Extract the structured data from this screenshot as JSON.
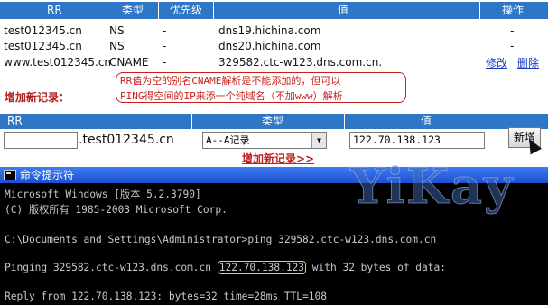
{
  "records_table": {
    "headers": [
      "RR",
      "类型",
      "优先级",
      "值",
      "操作"
    ],
    "rows": [
      {
        "rr": "test012345.cn",
        "type": "NS",
        "priority": "-",
        "value": "dns19.hichina.com",
        "action1": "",
        "action2": "-"
      },
      {
        "rr": "test012345.cn",
        "type": "NS",
        "priority": "-",
        "value": "dns20.hichina.com",
        "action1": "",
        "action2": "-"
      },
      {
        "rr": "www.test012345.cn",
        "type": "CNAME",
        "priority": "-",
        "value": "329582.ctc-w123.dns.com.cn.",
        "action1": "修改",
        "action2": "删除"
      }
    ]
  },
  "note": {
    "line1": "RR值为空的别名CNAME解析是不能添加的，但可以",
    "line2": "PING得空间的IP来添一个纯域名（不加www）解析"
  },
  "add_record": {
    "title": "增加新记录：",
    "headers": {
      "rr": "RR",
      "type": "类型",
      "value": "值"
    },
    "rr_input_value": "",
    "domain_suffix": ".test012345.cn",
    "type_selected": "A--A记录",
    "value_input": "122.70.138.123",
    "submit_label": "新增",
    "more_link": "增加新记录>>"
  },
  "console": {
    "title": "命令提示符",
    "lines": [
      "Microsoft Windows [版本 5.2.3790]",
      "(C) 版权所有 1985-2003 Microsoft Corp.",
      "",
      "C:\\Documents and Settings\\Administrator>ping 329582.ctc-w123.dns.com.cn",
      "",
      "Reply from 122.70.138.123: bytes=32 time=28ms TTL=108"
    ],
    "ping_line": {
      "before": "Pinging 329582.ctc-w123.dns.com.cn ",
      "ip": "122.70.138.123",
      "after": " with 32 bytes of data:"
    }
  },
  "watermark": "YiKay",
  "colors": {
    "header_bg": "#2f76c7",
    "accent_red": "#c9201b",
    "link": "#1a3cc0",
    "console_bg": "#000000",
    "titlebar": "#1d4fd0"
  }
}
